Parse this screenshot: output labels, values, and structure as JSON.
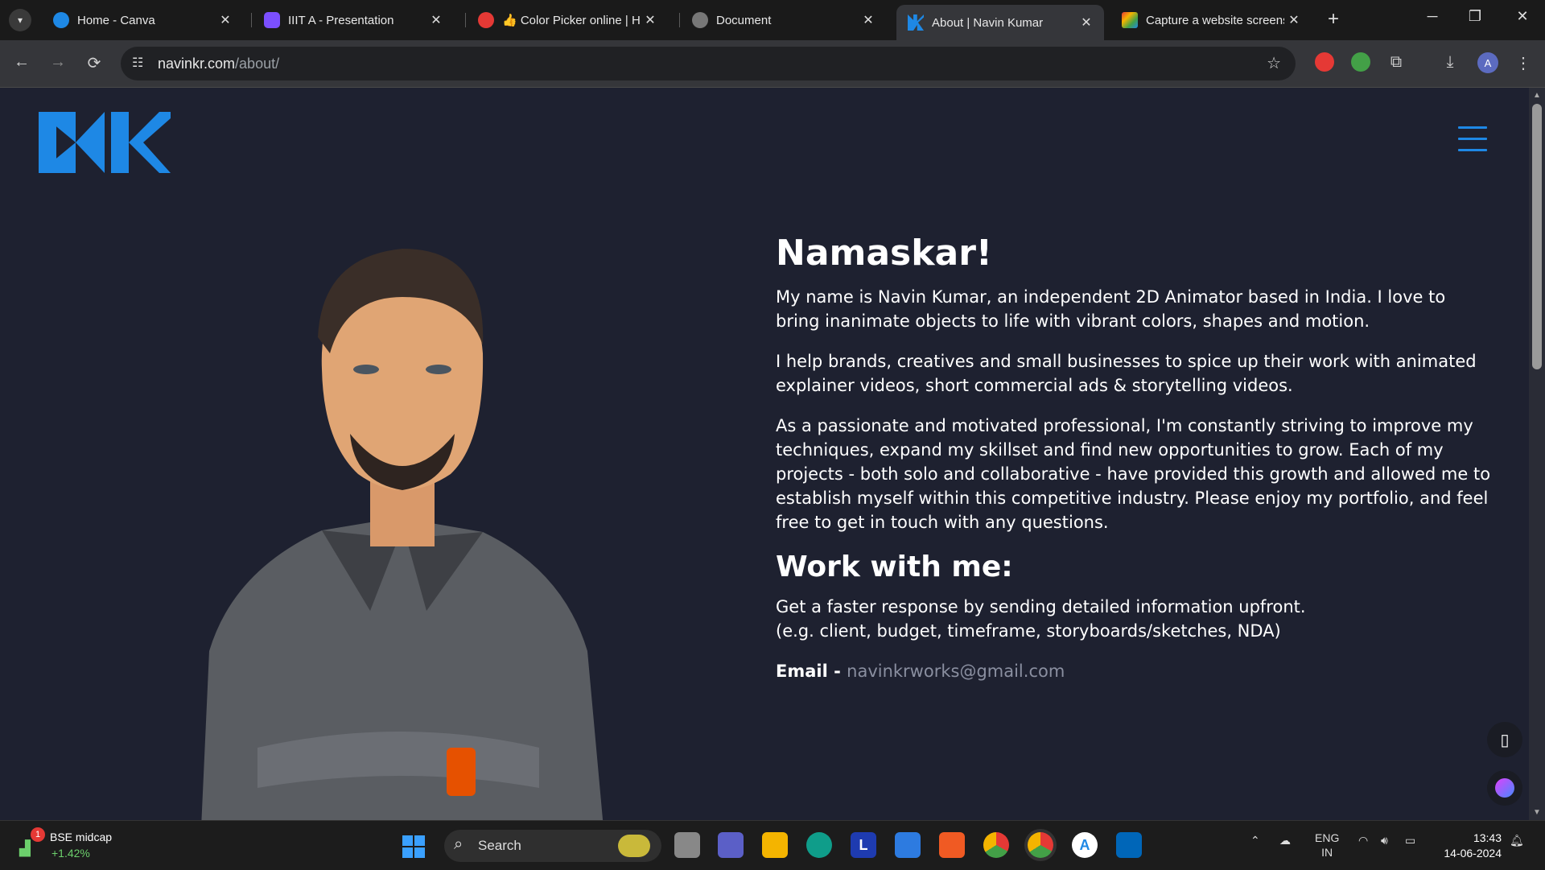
{
  "browser": {
    "tabs": [
      {
        "title": "Home - Canva",
        "icon": "canva-icon",
        "color": "#1e88e5"
      },
      {
        "title": "IIIT A - Presentation",
        "icon": "presentation-icon",
        "color": "#7b4fff"
      },
      {
        "title": "👍 Color Picker online | HE",
        "icon": "color-picker-icon",
        "color": "#e53935"
      },
      {
        "title": "Document",
        "icon": "document-icon",
        "color": "#777777"
      },
      {
        "title": "About | Navin Kumar",
        "icon": "nk-logo-icon",
        "color": "#1e88e5",
        "active": true
      },
      {
        "title": "Capture a website screenshot",
        "icon": "capture-icon",
        "color": "#f4b400"
      }
    ],
    "url_host": "navinkr.com",
    "url_path": "/about/",
    "profile_initial": "A"
  },
  "page": {
    "heading": "Namaskar!",
    "paragraphs": [
      "My name is Navin Kumar, an independent 2D Animator based in India. I love to bring inanimate objects to life with vibrant colors, shapes and motion.",
      "I help brands, creatives and small businesses to spice up their work with animated explainer videos, short commercial ads & storytelling videos.",
      "As a passionate and motivated professional, I'm constantly striving to improve my techniques, expand my skillset and find new opportunities to grow. Each of my projects - both solo and collaborative - have provided this growth and allowed me to establish myself within this competitive industry. Please enjoy my portfolio, and feel free to get in touch with any questions."
    ],
    "work_heading": "Work with me:",
    "work_text_1": "Get a faster response by sending detailed information upfront.",
    "work_text_2": "(e.g. client, budget, timeframe, storyboards/sketches, NDA)",
    "email_label": "Email - ",
    "email_value": "navinkrworks@gmail.com",
    "accent_color": "#1e88e5"
  },
  "taskbar": {
    "widget_badge": "1",
    "widget_name": "BSE midcap",
    "widget_change": "+1.42%",
    "search_label": "Search",
    "lang_1": "ENG",
    "lang_2": "IN",
    "time": "13:43",
    "date": "14-06-2024"
  }
}
